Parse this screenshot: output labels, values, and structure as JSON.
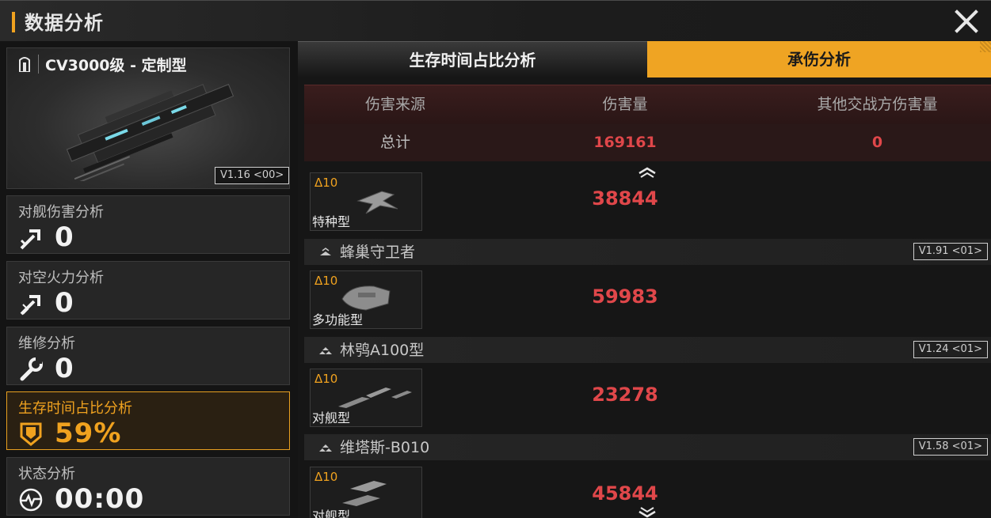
{
  "header": {
    "title": "数据分析"
  },
  "ship": {
    "name": "CV3000级 - 定制型",
    "version": "V1.16 <00>"
  },
  "stats": [
    {
      "label": "对舰伤害分析",
      "value": "0",
      "icon": "anti-ship-icon"
    },
    {
      "label": "对空火力分析",
      "value": "0",
      "icon": "anti-air-icon"
    },
    {
      "label": "维修分析",
      "value": "0",
      "icon": "wrench-icon"
    },
    {
      "label": "生存时间占比分析",
      "value": "59%",
      "icon": "shield-icon",
      "active": true
    },
    {
      "label": "状态分析",
      "value": "00:00",
      "icon": "heartbeat-icon"
    }
  ],
  "tabs": [
    {
      "label": "生存时间占比分析",
      "active": false
    },
    {
      "label": "承伤分析",
      "active": true
    }
  ],
  "table": {
    "columns": [
      "伤害来源",
      "伤害量",
      "其他交战方伤害量"
    ],
    "total": {
      "label": "总计",
      "damage": "169161",
      "other": "0"
    }
  },
  "groups": [
    {
      "name": "蜂巢守卫者",
      "version": "V1.91 <01>"
    },
    {
      "name": "林鸮A100型",
      "version": "V1.24 <01>"
    },
    {
      "name": "维塔斯-B010",
      "version": "V1.58 <01>"
    }
  ],
  "units": [
    {
      "level": "Δ10",
      "type": "特种型",
      "damage": "38844"
    },
    {
      "level": "Δ10",
      "type": "多功能型",
      "damage": "59983"
    },
    {
      "level": "Δ10",
      "type": "对舰型",
      "damage": "23278"
    },
    {
      "level": "Δ10",
      "type": "对舰型",
      "damage": "45844"
    }
  ],
  "colors": {
    "accent": "#f0a21f",
    "damage_red": "#e0474a",
    "active_tab": "#efa423"
  }
}
